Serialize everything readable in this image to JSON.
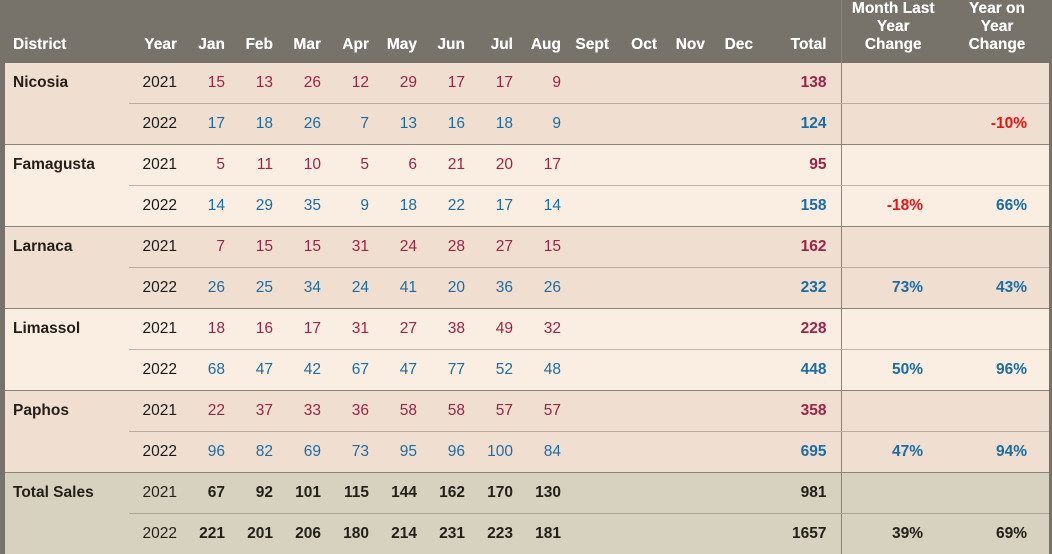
{
  "header": {
    "district": "District",
    "year": "Year",
    "months": [
      "Jan",
      "Feb",
      "Mar",
      "Apr",
      "May",
      "Jun",
      "Jul",
      "Aug",
      "Sept",
      "Oct",
      "Nov",
      "Dec"
    ],
    "total": "Total",
    "month_last_year_change": "Month Last Year Change",
    "year_on_year_change": "Year on Year Change"
  },
  "colors": {
    "header_bg": "#77736a",
    "group_dark": "#f0dfd0",
    "group_light": "#faeee2",
    "group_total": "#d7d1bf",
    "value_2021": "#9b2347",
    "value_2022": "#1a6da4",
    "negative": "#ee1111"
  },
  "chart_data": {
    "type": "table",
    "title": "District sales by month, 2021 vs 2022",
    "columns": [
      "District",
      "Year",
      "Jan",
      "Feb",
      "Mar",
      "Apr",
      "May",
      "Jun",
      "Jul",
      "Aug",
      "Sept",
      "Oct",
      "Nov",
      "Dec",
      "Total",
      "Month Last Year Change",
      "Year on Year Change"
    ],
    "rows": [
      {
        "district": "Nicosia",
        "year": "2021",
        "months": [
          "15",
          "13",
          "26",
          "12",
          "29",
          "17",
          "17",
          "9",
          "",
          "",
          "",
          ""
        ],
        "total": "138",
        "mly": "",
        "yoy": ""
      },
      {
        "district": "",
        "year": "2022",
        "months": [
          "17",
          "18",
          "26",
          "7",
          "13",
          "16",
          "18",
          "9",
          "",
          "",
          "",
          ""
        ],
        "total": "124",
        "mly": "",
        "yoy": "-10%"
      },
      {
        "district": "Famagusta",
        "year": "2021",
        "months": [
          "5",
          "11",
          "10",
          "5",
          "6",
          "21",
          "20",
          "17",
          "",
          "",
          "",
          ""
        ],
        "total": "95",
        "mly": "",
        "yoy": ""
      },
      {
        "district": "",
        "year": "2022",
        "months": [
          "14",
          "29",
          "35",
          "9",
          "18",
          "22",
          "17",
          "14",
          "",
          "",
          "",
          ""
        ],
        "total": "158",
        "mly": "-18%",
        "yoy": "66%"
      },
      {
        "district": "Larnaca",
        "year": "2021",
        "months": [
          "7",
          "15",
          "15",
          "31",
          "24",
          "28",
          "27",
          "15",
          "",
          "",
          "",
          ""
        ],
        "total": "162",
        "mly": "",
        "yoy": ""
      },
      {
        "district": "",
        "year": "2022",
        "months": [
          "26",
          "25",
          "34",
          "24",
          "41",
          "20",
          "36",
          "26",
          "",
          "",
          "",
          ""
        ],
        "total": "232",
        "mly": "73%",
        "yoy": "43%"
      },
      {
        "district": "Limassol",
        "year": "2021",
        "months": [
          "18",
          "16",
          "17",
          "31",
          "27",
          "38",
          "49",
          "32",
          "",
          "",
          "",
          ""
        ],
        "total": "228",
        "mly": "",
        "yoy": ""
      },
      {
        "district": "",
        "year": "2022",
        "months": [
          "68",
          "47",
          "42",
          "67",
          "47",
          "77",
          "52",
          "48",
          "",
          "",
          "",
          ""
        ],
        "total": "448",
        "mly": "50%",
        "yoy": "96%"
      },
      {
        "district": "Paphos",
        "year": "2021",
        "months": [
          "22",
          "37",
          "33",
          "36",
          "58",
          "58",
          "57",
          "57",
          "",
          "",
          "",
          ""
        ],
        "total": "358",
        "mly": "",
        "yoy": ""
      },
      {
        "district": "",
        "year": "2022",
        "months": [
          "96",
          "82",
          "69",
          "73",
          "95",
          "96",
          "100",
          "84",
          "",
          "",
          "",
          ""
        ],
        "total": "695",
        "mly": "47%",
        "yoy": "94%"
      },
      {
        "district": "Total Sales",
        "year": "2021",
        "months": [
          "67",
          "92",
          "101",
          "115",
          "144",
          "162",
          "170",
          "130",
          "",
          "",
          "",
          ""
        ],
        "total": "981",
        "mly": "",
        "yoy": ""
      },
      {
        "district": "",
        "year": "2022",
        "months": [
          "221",
          "201",
          "206",
          "180",
          "214",
          "231",
          "223",
          "181",
          "",
          "",
          "",
          ""
        ],
        "total": "1657",
        "mly": "39%",
        "yoy": "69%"
      }
    ]
  },
  "rows": [
    {
      "group": "g-dark",
      "rowtype": "row-2021",
      "district": "Nicosia",
      "year": "2021",
      "vclass": "v2021",
      "m": [
        "15",
        "13",
        "26",
        "12",
        "29",
        "17",
        "17",
        "9",
        "",
        "",
        "",
        ""
      ],
      "total": "138",
      "mly": "",
      "mly_sign": "",
      "yoy": "",
      "yoy_sign": ""
    },
    {
      "group": "g-dark",
      "rowtype": "row-2022",
      "district": "",
      "year": "2022",
      "vclass": "v2022",
      "m": [
        "17",
        "18",
        "26",
        "7",
        "13",
        "16",
        "18",
        "9",
        "",
        "",
        "",
        ""
      ],
      "total": "124",
      "mly": "",
      "mly_sign": "",
      "yoy": "-10%",
      "yoy_sign": "neg"
    },
    {
      "group": "g-light",
      "rowtype": "row-2021",
      "district": "Famagusta",
      "year": "2021",
      "vclass": "v2021",
      "m": [
        "5",
        "11",
        "10",
        "5",
        "6",
        "21",
        "20",
        "17",
        "",
        "",
        "",
        ""
      ],
      "total": "95",
      "mly": "",
      "mly_sign": "",
      "yoy": "",
      "yoy_sign": ""
    },
    {
      "group": "g-light",
      "rowtype": "row-2022",
      "district": "",
      "year": "2022",
      "vclass": "v2022",
      "m": [
        "14",
        "29",
        "35",
        "9",
        "18",
        "22",
        "17",
        "14",
        "",
        "",
        "",
        ""
      ],
      "total": "158",
      "mly": "-18%",
      "mly_sign": "neg",
      "yoy": "66%",
      "yoy_sign": "pos"
    },
    {
      "group": "g-dark",
      "rowtype": "row-2021",
      "district": "Larnaca",
      "year": "2021",
      "vclass": "v2021",
      "m": [
        "7",
        "15",
        "15",
        "31",
        "24",
        "28",
        "27",
        "15",
        "",
        "",
        "",
        ""
      ],
      "total": "162",
      "mly": "",
      "mly_sign": "",
      "yoy": "",
      "yoy_sign": ""
    },
    {
      "group": "g-dark",
      "rowtype": "row-2022",
      "district": "",
      "year": "2022",
      "vclass": "v2022",
      "m": [
        "26",
        "25",
        "34",
        "24",
        "41",
        "20",
        "36",
        "26",
        "",
        "",
        "",
        ""
      ],
      "total": "232",
      "mly": "73%",
      "mly_sign": "pos",
      "yoy": "43%",
      "yoy_sign": "pos"
    },
    {
      "group": "g-light",
      "rowtype": "row-2021",
      "district": "Limassol",
      "year": "2021",
      "vclass": "v2021",
      "m": [
        "18",
        "16",
        "17",
        "31",
        "27",
        "38",
        "49",
        "32",
        "",
        "",
        "",
        ""
      ],
      "total": "228",
      "mly": "",
      "mly_sign": "",
      "yoy": "",
      "yoy_sign": ""
    },
    {
      "group": "g-light",
      "rowtype": "row-2022",
      "district": "",
      "year": "2022",
      "vclass": "v2022",
      "m": [
        "68",
        "47",
        "42",
        "67",
        "47",
        "77",
        "52",
        "48",
        "",
        "",
        "",
        ""
      ],
      "total": "448",
      "mly": "50%",
      "mly_sign": "pos",
      "yoy": "96%",
      "yoy_sign": "pos"
    },
    {
      "group": "g-dark",
      "rowtype": "row-2021",
      "district": "Paphos",
      "year": "2021",
      "vclass": "v2021",
      "m": [
        "22",
        "37",
        "33",
        "36",
        "58",
        "58",
        "57",
        "57",
        "",
        "",
        "",
        ""
      ],
      "total": "358",
      "mly": "",
      "mly_sign": "",
      "yoy": "",
      "yoy_sign": ""
    },
    {
      "group": "g-dark",
      "rowtype": "row-2022",
      "district": "",
      "year": "2022",
      "vclass": "v2022",
      "m": [
        "96",
        "82",
        "69",
        "73",
        "95",
        "96",
        "100",
        "84",
        "",
        "",
        "",
        ""
      ],
      "total": "695",
      "mly": "47%",
      "mly_sign": "pos",
      "yoy": "94%",
      "yoy_sign": "pos"
    },
    {
      "group": "g-total",
      "rowtype": "row-2021",
      "district": "Total Sales",
      "year": "2021",
      "vclass": "v2021",
      "m": [
        "67",
        "92",
        "101",
        "115",
        "144",
        "162",
        "170",
        "130",
        "",
        "",
        "",
        ""
      ],
      "total": "981",
      "mly": "",
      "mly_sign": "",
      "yoy": "",
      "yoy_sign": ""
    },
    {
      "group": "g-total",
      "rowtype": "row-2022 last",
      "district": "",
      "year": "2022",
      "vclass": "v2022",
      "m": [
        "221",
        "201",
        "206",
        "180",
        "214",
        "231",
        "223",
        "181",
        "",
        "",
        "",
        ""
      ],
      "total": "1657",
      "mly": "39%",
      "mly_sign": "pos",
      "yoy": "69%",
      "yoy_sign": "pos"
    }
  ]
}
